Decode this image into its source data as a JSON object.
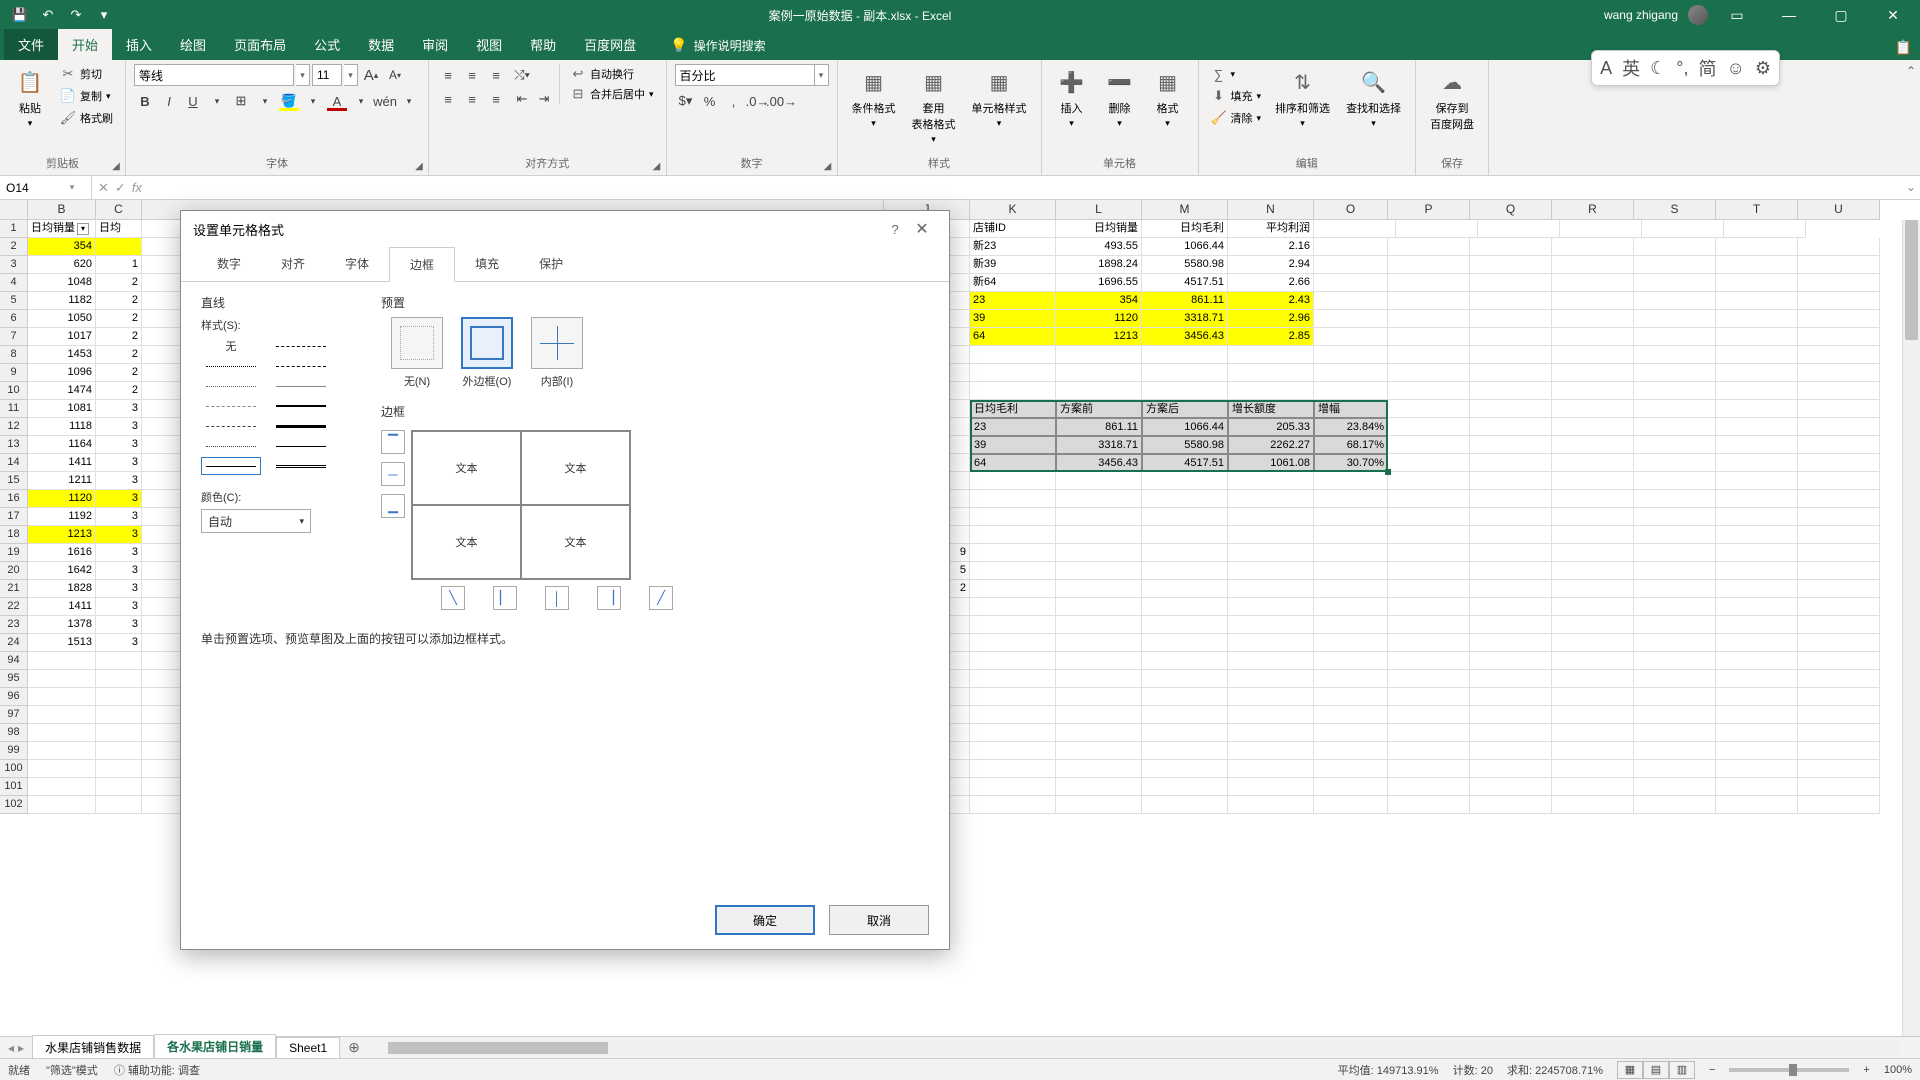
{
  "title": "案例一原始数据 - 副本.xlsx - Excel",
  "user": "wang zhigang",
  "qat": {
    "save": "💾",
    "undo": "↶",
    "redo": "↷"
  },
  "tabs": {
    "file": "文件",
    "home": "开始",
    "insert": "插入",
    "draw": "绘图",
    "layout": "页面布局",
    "formulas": "公式",
    "data": "数据",
    "review": "审阅",
    "view": "视图",
    "help": "帮助",
    "baidu": "百度网盘"
  },
  "tell_me": "操作说明搜索",
  "ribbon": {
    "clipboard": {
      "paste": "粘贴",
      "cut": "剪切",
      "copy": "复制",
      "format_painter": "格式刷",
      "label": "剪贴板"
    },
    "font": {
      "name": "等线",
      "size": "11",
      "increase": "A",
      "decrease": "A",
      "bold": "B",
      "italic": "I",
      "underline": "U",
      "label": "字体"
    },
    "alignment": {
      "wrap": "自动换行",
      "merge": "合并后居中",
      "label": "对齐方式"
    },
    "number": {
      "format": "百分比",
      "label": "数字"
    },
    "styles": {
      "cond": "条件格式",
      "table": "套用\n表格格式",
      "cell": "单元格样式",
      "label": "样式"
    },
    "cells": {
      "insert": "插入",
      "delete": "删除",
      "format": "格式",
      "label": "单元格"
    },
    "editing": {
      "sum": "∑",
      "fill": "填充",
      "clear": "清除",
      "sort": "排序和筛选",
      "find": "查找和选择",
      "label": "编辑"
    },
    "save": {
      "btn": "保存到\n百度网盘",
      "label": "保存"
    }
  },
  "float": {
    "a": "A",
    "en": "英",
    "moon": "☾",
    "cn": "简",
    "smile": "☺",
    "gear": "⚙"
  },
  "namebox": "O14",
  "colB_header": "日均销量",
  "colC_header_partial": "日均",
  "colB": [
    "354",
    "620",
    "1048",
    "1182",
    "1050",
    "1017",
    "1453",
    "1096",
    "1474",
    "1081",
    "1118",
    "1164",
    "1411",
    "1211",
    "1120",
    "1192",
    "1213",
    "1616",
    "1642",
    "1828",
    "1411",
    "1378",
    "1513"
  ],
  "colC": [
    "",
    "1",
    "2",
    "2",
    "2",
    "2",
    "2",
    "2",
    "2",
    "3",
    "3",
    "3",
    "3",
    "3",
    "3",
    "3",
    "3",
    "3",
    "3",
    "3",
    "3",
    "3",
    "3"
  ],
  "yellow_rows_b": [
    0,
    14,
    16
  ],
  "right_top": {
    "headers": [
      "店铺ID",
      "日均销量",
      "日均毛利",
      "平均利润"
    ],
    "rows": [
      [
        "新23",
        "493.55",
        "1066.44",
        "2.16"
      ],
      [
        "新39",
        "1898.24",
        "5580.98",
        "2.94"
      ],
      [
        "新64",
        "1696.55",
        "4517.51",
        "2.66"
      ],
      [
        "23",
        "354",
        "861.11",
        "2.43"
      ],
      [
        "39",
        "1120",
        "3318.71",
        "2.96"
      ],
      [
        "64",
        "1213",
        "3456.43",
        "2.85"
      ]
    ],
    "yellow_rows": [
      3,
      4,
      5
    ]
  },
  "sel_block": {
    "headers": [
      "日均毛利",
      "方案前",
      "方案后",
      "增长额度",
      "增幅"
    ],
    "rows": [
      [
        "23",
        "861.11",
        "1066.44",
        "205.33",
        "23.84%"
      ],
      [
        "39",
        "3318.71",
        "5580.98",
        "2262.27",
        "68.17%"
      ],
      [
        "64",
        "3456.43",
        "4517.51",
        "1061.08",
        "30.70%"
      ]
    ]
  },
  "stray": {
    "r18": "9",
    "r19": "5",
    "r20": "2"
  },
  "sheets": {
    "s1": "水果店铺销售数据",
    "s2": "各水果店铺日销量",
    "s3": "Sheet1"
  },
  "status": {
    "ready": "就绪",
    "filter": "\"筛选\"模式",
    "acc": "辅助功能: 调查",
    "avg_label": "平均值:",
    "avg": "149713.91%",
    "count_label": "计数:",
    "count": "20",
    "sum_label": "求和:",
    "sum": "2245708.71%",
    "zoom": "100%"
  },
  "dialog": {
    "title": "设置单元格格式",
    "tabs": {
      "number": "数字",
      "align": "对齐",
      "font": "字体",
      "border": "边框",
      "fill": "填充",
      "protect": "保护"
    },
    "line_label": "直线",
    "style_label": "样式(S):",
    "style_none": "无",
    "preset_label": "预置",
    "presets": {
      "none": "无(N)",
      "outline": "外边框(O)",
      "inside": "内部(I)"
    },
    "border_label": "边框",
    "preview_text": "文本",
    "color_label": "颜色(C):",
    "color_auto": "自动",
    "hint": "单击预置选项、预览草图及上面的按钮可以添加边框样式。",
    "ok": "确定",
    "cancel": "取消"
  },
  "cols": [
    "B",
    "C",
    "",
    "K",
    "L",
    "M",
    "N",
    "O",
    "P",
    "Q",
    "R",
    "S",
    "T",
    "U"
  ]
}
